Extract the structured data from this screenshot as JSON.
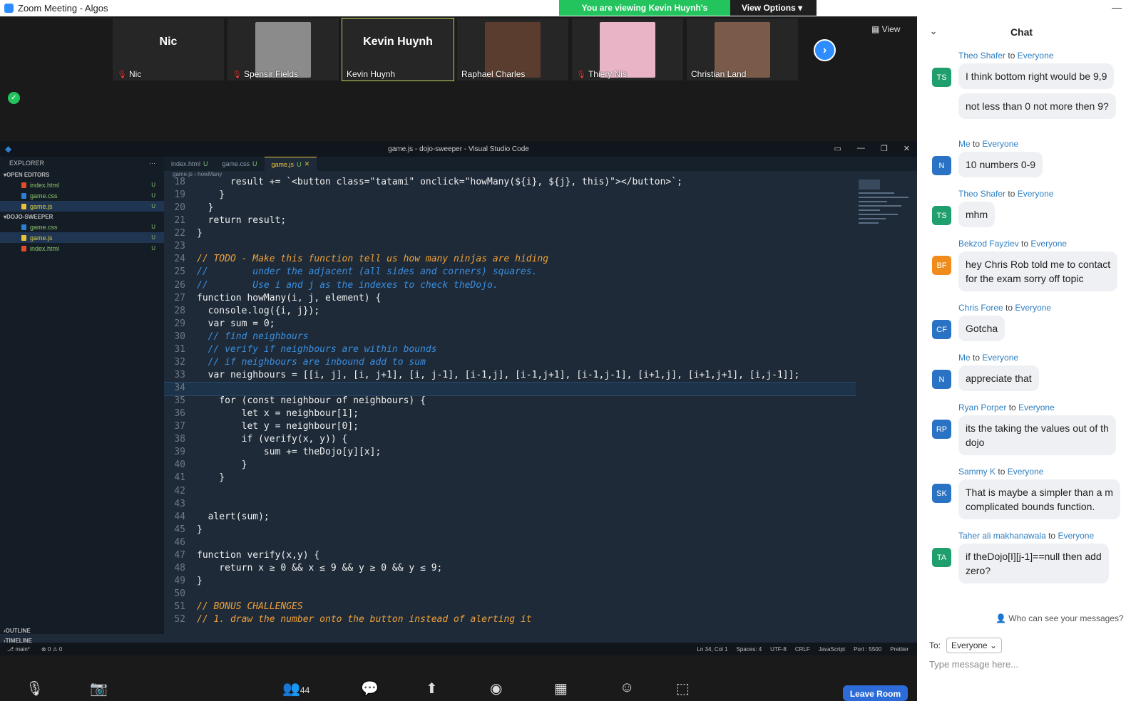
{
  "window": {
    "title": "Zoom Meeting - Algos"
  },
  "banner": {
    "viewing": "You are viewing Kevin Huynh's screen",
    "view_options": "View Options"
  },
  "participants": [
    {
      "name": "Nic",
      "display": "Nic",
      "muted": true,
      "photo": false
    },
    {
      "name": "Spensir Fields",
      "muted": true,
      "photo": true,
      "color": "#8b8b8b"
    },
    {
      "name": "Kevin Huynh",
      "display": "Kevin Huynh",
      "muted": false,
      "photo": false,
      "active": true
    },
    {
      "name": "Raphael Charles",
      "muted": false,
      "photo": true,
      "color": "#5a3d2e"
    },
    {
      "name": "Thiery Nis",
      "muted": true,
      "photo": true,
      "color": "#e8b4c6"
    },
    {
      "name": "Christian Land",
      "muted": false,
      "photo": true,
      "color": "#7a5b4a"
    }
  ],
  "view_button": "View",
  "vscode": {
    "title": "game.js - dojo-sweeper - Visual Studio Code",
    "explorer_label": "EXPLORER",
    "open_editors_label": "OPEN EDITORS",
    "project_label": "DOJO-SWEEPER",
    "open_editors": [
      {
        "name": "index.html",
        "type": "html",
        "flag": "U"
      },
      {
        "name": "game.css",
        "type": "css",
        "flag": "U"
      },
      {
        "name": "game.js",
        "type": "js",
        "flag": "U"
      }
    ],
    "project_files": [
      {
        "name": "game.css",
        "type": "css",
        "flag": "U"
      },
      {
        "name": "game.js",
        "type": "js",
        "flag": "U"
      },
      {
        "name": "index.html",
        "type": "html",
        "flag": "U"
      }
    ],
    "outline": "OUTLINE",
    "timeline": "TIMELINE",
    "tabs": [
      {
        "name": "index.html",
        "flag": "U"
      },
      {
        "name": "game.css",
        "flag": "U"
      },
      {
        "name": "game.js",
        "flag": "U"
      }
    ],
    "breadcrumb": {
      "file": "game.js",
      "symbol": "howMany"
    },
    "code_lines": [
      {
        "n": "18",
        "t": "      result += `<button class=\"tatami\" onclick=\"howMany(${i}, ${j}, this)\"></button>`;"
      },
      {
        "n": "19",
        "t": "    }"
      },
      {
        "n": "20",
        "t": "  }"
      },
      {
        "n": "21",
        "t": "  return result;"
      },
      {
        "n": "22",
        "t": "}"
      },
      {
        "n": "23",
        "t": ""
      },
      {
        "n": "24",
        "t": "// TODO - Make this function tell us how many ninjas are hiding"
      },
      {
        "n": "25",
        "t": "//        under the adjacent (all sides and corners) squares."
      },
      {
        "n": "26",
        "t": "//        Use i and j as the indexes to check theDojo."
      },
      {
        "n": "27",
        "t": "function howMany(i, j, element) {"
      },
      {
        "n": "28",
        "t": "  console.log({i, j});"
      },
      {
        "n": "29",
        "t": "  var sum = 0;"
      },
      {
        "n": "30",
        "t": "  // find neighbours"
      },
      {
        "n": "31",
        "t": "  // verify if neighbours are within bounds"
      },
      {
        "n": "32",
        "t": "  // if neighbours are inbound add to sum"
      },
      {
        "n": "33",
        "t": "  var neighbours = [[i, j], [i, j+1], [i, j-1], [i-1,j], [i-1,j+1], [i-1,j-1], [i+1,j], [i+1,j+1], [i,j-1]];"
      },
      {
        "n": "34",
        "t": ""
      },
      {
        "n": "35",
        "t": "    for (const neighbour of neighbours) {"
      },
      {
        "n": "36",
        "t": "        let x = neighbour[1];"
      },
      {
        "n": "37",
        "t": "        let y = neighbour[0];"
      },
      {
        "n": "38",
        "t": "        if (verify(x, y)) {"
      },
      {
        "n": "39",
        "t": "            sum += theDojo[y][x];"
      },
      {
        "n": "40",
        "t": "        }"
      },
      {
        "n": "41",
        "t": "    }"
      },
      {
        "n": "42",
        "t": ""
      },
      {
        "n": "43",
        "t": ""
      },
      {
        "n": "44",
        "t": "  alert(sum);"
      },
      {
        "n": "45",
        "t": "}"
      },
      {
        "n": "46",
        "t": ""
      },
      {
        "n": "47",
        "t": "function verify(x,y) {"
      },
      {
        "n": "48",
        "t": "    return x ≥ 0 && x ≤ 9 && y ≥ 0 && y ≤ 9;"
      },
      {
        "n": "49",
        "t": "}"
      },
      {
        "n": "50",
        "t": ""
      },
      {
        "n": "51",
        "t": "// BONUS CHALLENGES"
      },
      {
        "n": "52",
        "t": "// 1. draw the number onto the button instead of alerting it"
      }
    ],
    "status": {
      "branch": "main*",
      "problems": "⊗ 0 ⚠ 0",
      "position": "Ln 34, Col 1",
      "spaces": "Spaces: 4",
      "encoding": "UTF-8",
      "eol": "CRLF",
      "language": "JavaScript",
      "port": "Port : 5500",
      "prettier": "Prettier"
    }
  },
  "toolbar": {
    "participants_count": "44",
    "leave": "Leave Room"
  },
  "chat": {
    "title": "Chat",
    "messages": [
      {
        "from": "Theo Shafer",
        "to": "Everyone",
        "initials": "TS",
        "color": "#1f9e6e",
        "lines": [
          "I think bottom right would be 9,9",
          "not less than 0 not more then 9?"
        ]
      },
      {
        "from": "Me",
        "to": "Everyone",
        "initials": "N",
        "color": "#2a73c4",
        "lines": [
          "10 numbers 0-9"
        ]
      },
      {
        "from": "Theo Shafer",
        "to": "Everyone",
        "initials": "TS",
        "color": "#1f9e6e",
        "lines": [
          "mhm"
        ]
      },
      {
        "from": "Bekzod Fayziev",
        "to": "Everyone",
        "initials": "BF",
        "color": "#f08c1b",
        "lines": [
          "hey Chris Rob told me to contact",
          "for the exam sorry off topic"
        ]
      },
      {
        "from": "Chris Foree",
        "to": "Everyone",
        "initials": "CF",
        "color": "#2a73c4",
        "lines": [
          "Gotcha"
        ]
      },
      {
        "from": "Me",
        "to": "Everyone",
        "initials": "N",
        "color": "#2a73c4",
        "lines": [
          "appreciate that"
        ]
      },
      {
        "from": "Ryan Porper",
        "to": "Everyone",
        "initials": "RP",
        "color": "#2a73c4",
        "lines": [
          "its the taking the values out of th",
          "dojo"
        ]
      },
      {
        "from": "Sammy K",
        "to": "Everyone",
        "initials": "SK",
        "color": "#2a73c4",
        "lines": [
          "That is maybe a simpler than a m",
          "complicated bounds function."
        ]
      },
      {
        "from": "Taher ali makhanawala",
        "to": "Everyone",
        "initials": "TA",
        "color": "#1f9e6e",
        "lines": [
          "if theDojo[I][j-1]==null then add",
          "zero?"
        ]
      }
    ],
    "to_word": "to",
    "who_can_see": "Who can see your messages?",
    "to_label": "To:",
    "to_value": "Everyone",
    "placeholder": "Type message here..."
  }
}
